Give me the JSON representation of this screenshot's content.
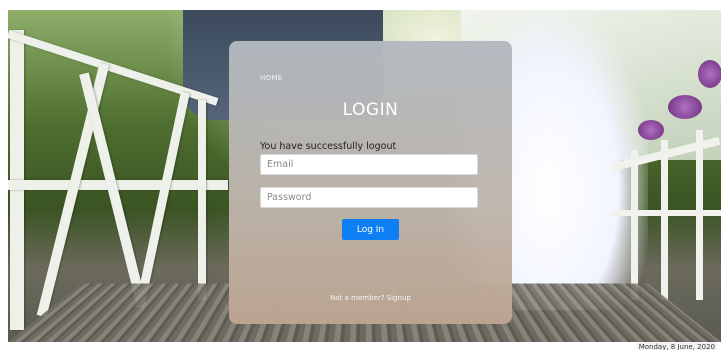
{
  "page": {
    "home_link": "HOME",
    "title": "LOGIN",
    "message": "You have successfully logout",
    "email_placeholder": "Email",
    "password_placeholder": "Password",
    "login_button": "Log In",
    "signup_link": "Not a member? Signup",
    "date_text": "Monday, 8 June, 2020"
  },
  "colors": {
    "button": "#0d7ff2",
    "panel_top": "#b2b9c0",
    "panel_bottom": "#bea591"
  }
}
